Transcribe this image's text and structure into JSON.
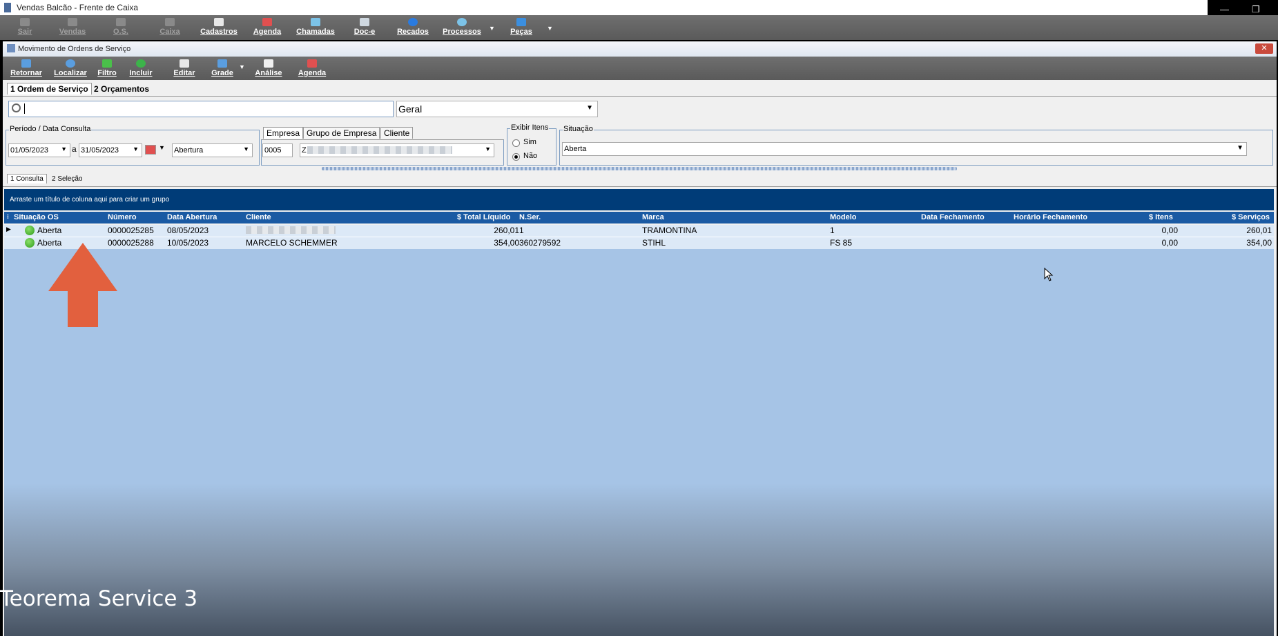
{
  "window": {
    "title": "Vendas Balcão - Frente de Caixa"
  },
  "main_toolbar": [
    {
      "label": "Sair",
      "enabled": false,
      "icon": "exit-icon"
    },
    {
      "label": "Vendas",
      "enabled": false,
      "icon": "sales-icon"
    },
    {
      "label": "O.S.",
      "enabled": false,
      "icon": "tools-icon"
    },
    {
      "label": "Caixa",
      "enabled": false,
      "icon": "cash-register-icon"
    },
    {
      "label": "Cadastros",
      "enabled": true,
      "icon": "register-icon"
    },
    {
      "label": "Agenda",
      "enabled": true,
      "icon": "calendar-icon"
    },
    {
      "label": "Chamadas",
      "enabled": true,
      "icon": "phone-list-icon"
    },
    {
      "label": "Doc-e",
      "enabled": true,
      "icon": "document-icon"
    },
    {
      "label": "Recados",
      "enabled": true,
      "icon": "message-icon"
    },
    {
      "label": "Processos",
      "enabled": true,
      "icon": "gear-icon"
    },
    {
      "label": "Peças",
      "enabled": true,
      "icon": "wrench-icon"
    }
  ],
  "inner": {
    "title": "Movimento de Ordens de Serviço",
    "close": "✕",
    "toolbar": [
      {
        "label": "Retornar",
        "icon": "back-icon",
        "color": "#5a9ee0"
      },
      {
        "label": "Localizar",
        "icon": "search-icon",
        "color": "#5a9ee0"
      },
      {
        "label": "Filtro",
        "icon": "filter-icon",
        "color": "#4ac04a"
      },
      {
        "label": "Incluir",
        "icon": "add-icon",
        "color": "#3cb44a"
      },
      {
        "label": "Editar",
        "icon": "edit-icon",
        "color": "#ffffff"
      },
      {
        "label": "Grade",
        "icon": "grid-icon",
        "color": "#5a9ee0"
      },
      {
        "label": "Análise",
        "icon": "analysis-icon",
        "color": "#ffffff"
      },
      {
        "label": "Agenda",
        "icon": "calendar-icon",
        "color": "#e05050"
      }
    ],
    "tabs": [
      "1 Ordem de Serviço",
      "2 Orçamentos"
    ],
    "search": {
      "value": "",
      "scope": "Geral"
    },
    "periodo": {
      "caption": "Período / Data Consulta",
      "from": "01/05/2023",
      "sep": "a",
      "to": "31/05/2023",
      "type": "Abertura"
    },
    "empresa_tabs": [
      "Empresa",
      "Grupo de Empresa",
      "Cliente"
    ],
    "empresa": {
      "code": "0005",
      "name": "Z"
    },
    "exibir_itens": {
      "caption": "Exibir Itens",
      "options": [
        "Sim",
        "Não"
      ],
      "selected": "Não"
    },
    "situacao": {
      "caption": "Situação",
      "value": "Aberta"
    },
    "subtabs": [
      "1 Consulta",
      "2 Seleção"
    ],
    "group_hint": "Arraste um título de coluna aqui para criar um grupo",
    "grid": {
      "columns": [
        "Situação OS",
        "Número",
        "Data Abertura",
        "Cliente",
        "$ Total Líquido",
        "N.Ser.",
        "Marca",
        "Modelo",
        "Data Fechamento",
        "Horário Fechamento",
        "$ Itens",
        "$ Serviços"
      ],
      "rows": [
        {
          "situacao": "Aberta",
          "numero": "0000025285",
          "data": "08/05/2023",
          "cliente": "",
          "total": "260,01",
          "nser": "1",
          "marca": "TRAMONTINA",
          "modelo": "1",
          "data_fech": "",
          "hora_fech": "",
          "itens": "0,00",
          "servicos": "260,01"
        },
        {
          "situacao": "Aberta",
          "numero": "0000025288",
          "data": "10/05/2023",
          "cliente": "MARCELO SCHEMMER",
          "total": "354,00",
          "nser": "360279592",
          "marca": "STIHL",
          "modelo": "FS 85",
          "data_fech": "",
          "hora_fech": "",
          "itens": "0,00",
          "servicos": "354,00"
        }
      ]
    }
  },
  "watermark": "Teorema Service 3"
}
